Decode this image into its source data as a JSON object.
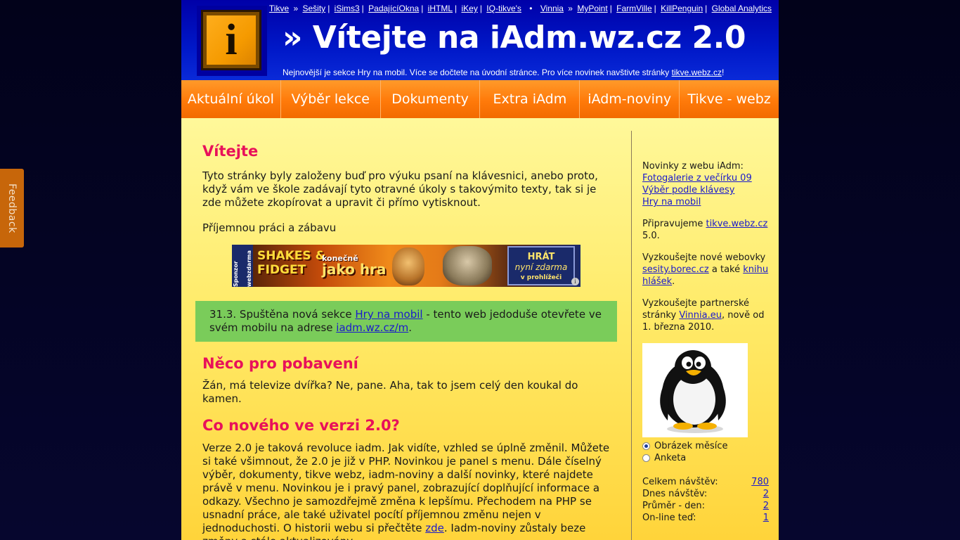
{
  "feedback": {
    "label": "Feedback"
  },
  "header": {
    "logo_letter": "i",
    "title": "» Vítejte na iAdm.wz.cz 2.0",
    "subtitle_text": "Nejnovější je sekce Hry na mobil. Více se dočtete na úvodní stránce. Pro více novinek navštivte stránky ",
    "subtitle_link": "tikve.webz.cz",
    "subtitle_end": "!",
    "toplinks_left": [
      {
        "label": "Tikve"
      },
      {
        "label": "Sešity"
      },
      {
        "label": "iSims3"
      },
      {
        "label": "PadajícíOkna"
      },
      {
        "label": "iHTML"
      },
      {
        "label": "iKey"
      },
      {
        "label": "IQ-tikve's"
      }
    ],
    "toplinks_left_first_sep": "»",
    "toplinks_bullet": "•",
    "toplinks_right": [
      {
        "label": "Vinnia"
      },
      {
        "label": "MyPoint"
      },
      {
        "label": "FarmVille"
      },
      {
        "label": "KillPenguin"
      },
      {
        "label": "Global Analytics"
      }
    ],
    "toplinks_right_first_sep": "»"
  },
  "menu": {
    "items": [
      {
        "label": "Aktuální úkol"
      },
      {
        "label": "Výběr lekce"
      },
      {
        "label": "Dokumenty"
      },
      {
        "label": "Extra iAdm"
      },
      {
        "label": "iAdm-noviny"
      },
      {
        "label": "Tikve - webz"
      }
    ]
  },
  "main": {
    "welcome_heading": "Vítejte",
    "welcome_text": "Tyto stránky byly založeny buď pro výuku psaní na klávesnici, anebo proto, když vám ve škole zadávají tyto otravné úkoly s takovýmito texty, tak si je zde můžete zkopírovat a upravit či přímo vytisknout.",
    "enjoy_text": "Příjemnou práci a zábavu",
    "banner": {
      "side_text": "Sponzor webzdarma",
      "logo_line1": "SHAKES &",
      "logo_line2": "FIDGET",
      "tag": "konečně",
      "big": "jako hra",
      "btn_line1": "HRÁT",
      "btn_line2": "nyní zdarma",
      "btn_line3": "v prohlížeči",
      "info": "i"
    },
    "notice": {
      "prefix": "31.3. Spuštěna nová sekce ",
      "link1": "Hry na mobil",
      "middle": " - tento web jedoduše otevřete ve svém mobilu na adrese ",
      "link2": "iadm.wz.cz/m",
      "suffix": "."
    },
    "fun_heading": "Něco pro pobavení",
    "fun_text": "Žán, má televize dvířka? Ne, pane. Aha, tak to jsem celý den koukal do kamen.",
    "new_heading": "Co nového ve verzi 2.0?",
    "new_text": "Verze 2.0 je taková revoluce iadm. Jak vidíte, vzhled se úplně změnil. Můžete si také všimnout, že 2.0 je již v PHP. Novinkou je panel s menu. Dále číselný výběr, dokumenty, tikve webz, iadm-noviny a další novinky, které najdete právě v menu. Novinkou je i pravý panel, zobrazující doplňující informace a odkazy. Všechno je samozdřejmě změna k lepšímu. Přechodem na PHP se usnadní práce, ale také uživatel pocítí příjemnou změnu nejen v jednoduchosti. O historii webu si přečtěte ",
    "new_link": "zde",
    "new_text_end": ". Iadm-noviny zůstaly beze změny a stále aktualizovány."
  },
  "sidebar": {
    "news_heading": "Novinky z webu iAdm:",
    "news_links": [
      {
        "label": "Fotogalerie z večírku 09"
      },
      {
        "label": "Výběr podle klávesy"
      },
      {
        "label": "Hry na mobil"
      }
    ],
    "prepare_text": "Připravujeme ",
    "prepare_link": "tikve.webz.cz",
    "prepare_end": " 5.0.",
    "try_text": "Vyzkoušejte nové webovky ",
    "try_link1": "sesity.borec.cz",
    "try_mid": " a také ",
    "try_link2": "knihu hlášek",
    "try_end": ".",
    "partner_text": "Vyzkoušejte partnerské stránky ",
    "partner_link": "Vinnia.eu",
    "partner_end": ", nově od 1. března 2010.",
    "radio_options": [
      {
        "label": "Obrázek měsíce",
        "checked": true
      },
      {
        "label": "Anketa",
        "checked": false
      }
    ],
    "stats": [
      {
        "label": "Celkem návštěv:",
        "value": "780"
      },
      {
        "label": "Dnes návštěv:",
        "value": "2"
      },
      {
        "label": "Průměr - den:",
        "value": "2"
      },
      {
        "label": "On-line teď:",
        "value": "1"
      }
    ]
  }
}
